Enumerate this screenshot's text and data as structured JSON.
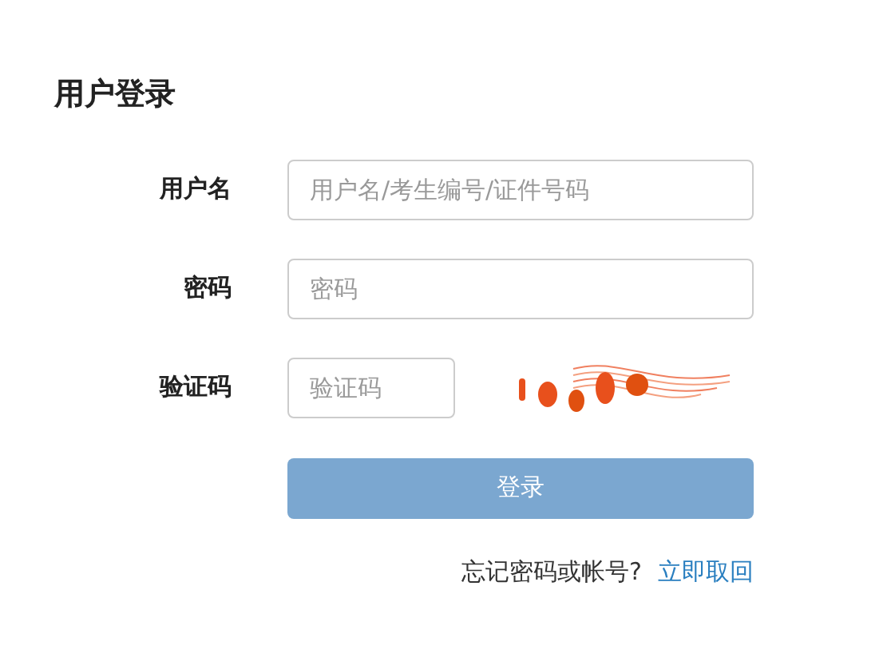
{
  "title": "用户登录",
  "fields": [
    {
      "label": "用户名",
      "placeholder": "用户名/考生编号/证件号码",
      "kind": "text"
    },
    {
      "label": "密码",
      "placeholder": "密码",
      "kind": "password"
    },
    {
      "label": "验证码",
      "placeholder": "验证码",
      "kind": "captcha"
    }
  ],
  "submit": "登录",
  "forgot": {
    "text": "忘记密码或帐号?",
    "link": "立即取回"
  }
}
